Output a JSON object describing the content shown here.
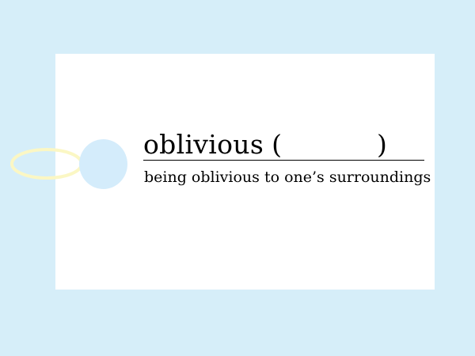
{
  "vocab_card": {
    "word": "oblivious",
    "blank_open": "(",
    "blank_close": ")",
    "definition": "being oblivious to one’s surroundings"
  },
  "colors": {
    "background": "#d6eef9",
    "card": "#ffffff",
    "hole": "#d4ecfb",
    "string": "#fbf7c4",
    "text": "#000000"
  },
  "icons": {
    "tag_string": "string-loop-icon",
    "tag_hole": "tag-hole-icon"
  }
}
